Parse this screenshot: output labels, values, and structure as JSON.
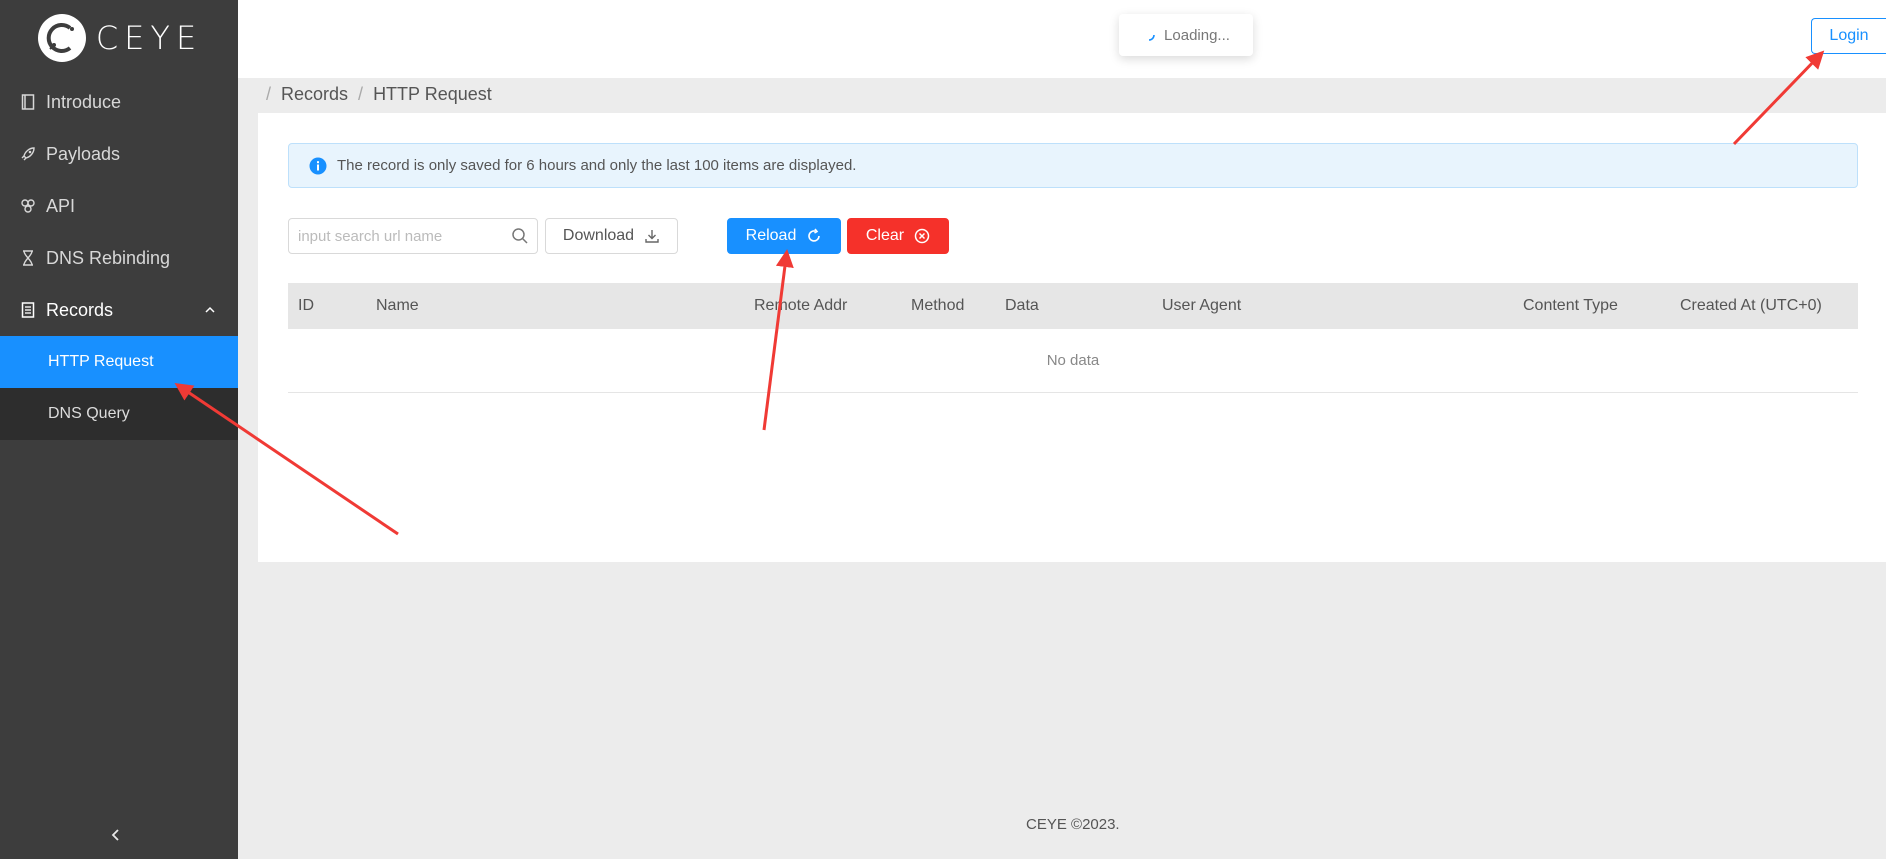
{
  "app": {
    "logo_text": "CEYE"
  },
  "sidebar": {
    "items": [
      {
        "label": "Introduce",
        "icon": "book-icon"
      },
      {
        "label": "Payloads",
        "icon": "rocket-icon"
      },
      {
        "label": "API",
        "icon": "api-icon"
      },
      {
        "label": "DNS Rebinding",
        "icon": "hourglass-icon"
      },
      {
        "label": "Records",
        "icon": "records-icon",
        "expanded": true
      }
    ],
    "submenu": [
      {
        "label": "HTTP Request",
        "active": true
      },
      {
        "label": "DNS Query",
        "active": false
      }
    ],
    "collapse_icon": "chevron-left-icon"
  },
  "header": {
    "loading_text": "Loading...",
    "login_label": "Login"
  },
  "breadcrumb": {
    "items": [
      "Records",
      "HTTP Request"
    ]
  },
  "alert": {
    "text": "The record is only saved for 6 hours and only the last 100 items are displayed."
  },
  "toolbar": {
    "search_placeholder": "input search url name",
    "download_label": "Download",
    "reload_label": "Reload",
    "clear_label": "Clear"
  },
  "table": {
    "columns": [
      "ID",
      "Name",
      "Remote Addr",
      "Method",
      "Data",
      "User Agent",
      "Content Type",
      "Created At (UTC+0)"
    ],
    "empty_text": "No data"
  },
  "footer": {
    "text": "CEYE ©2023."
  },
  "colors": {
    "primary": "#1890ff",
    "danger": "#f5312a",
    "sidebar_bg": "#3d3d3d",
    "annotation": "#f03a35"
  }
}
